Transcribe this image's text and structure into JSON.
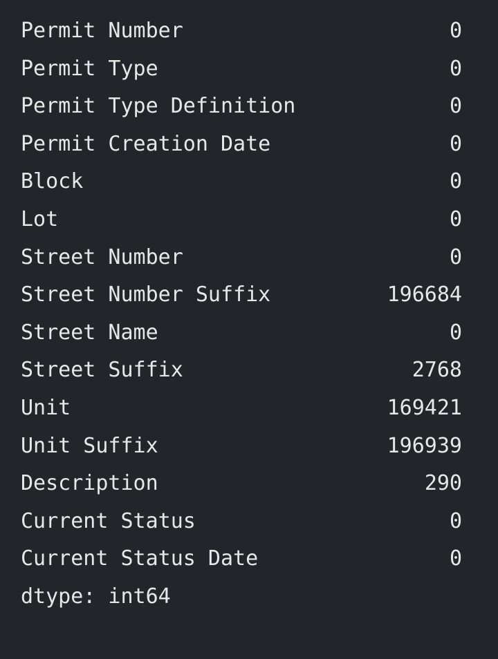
{
  "series": {
    "rows": [
      {
        "label": "Permit Number",
        "value": "0"
      },
      {
        "label": "Permit Type",
        "value": "0"
      },
      {
        "label": "Permit Type Definition",
        "value": "0"
      },
      {
        "label": "Permit Creation Date",
        "value": "0"
      },
      {
        "label": "Block",
        "value": "0"
      },
      {
        "label": "Lot",
        "value": "0"
      },
      {
        "label": "Street Number",
        "value": "0"
      },
      {
        "label": "Street Number Suffix",
        "value": "196684"
      },
      {
        "label": "Street Name",
        "value": "0"
      },
      {
        "label": "Street Suffix",
        "value": "2768"
      },
      {
        "label": "Unit",
        "value": "169421"
      },
      {
        "label": "Unit Suffix",
        "value": "196939"
      },
      {
        "label": "Description",
        "value": "290"
      },
      {
        "label": "Current Status",
        "value": "0"
      },
      {
        "label": "Current Status Date",
        "value": "0"
      }
    ],
    "dtype_line": "dtype: int64"
  },
  "colors": {
    "background": "#23252a",
    "text": "#e7e7e7"
  }
}
